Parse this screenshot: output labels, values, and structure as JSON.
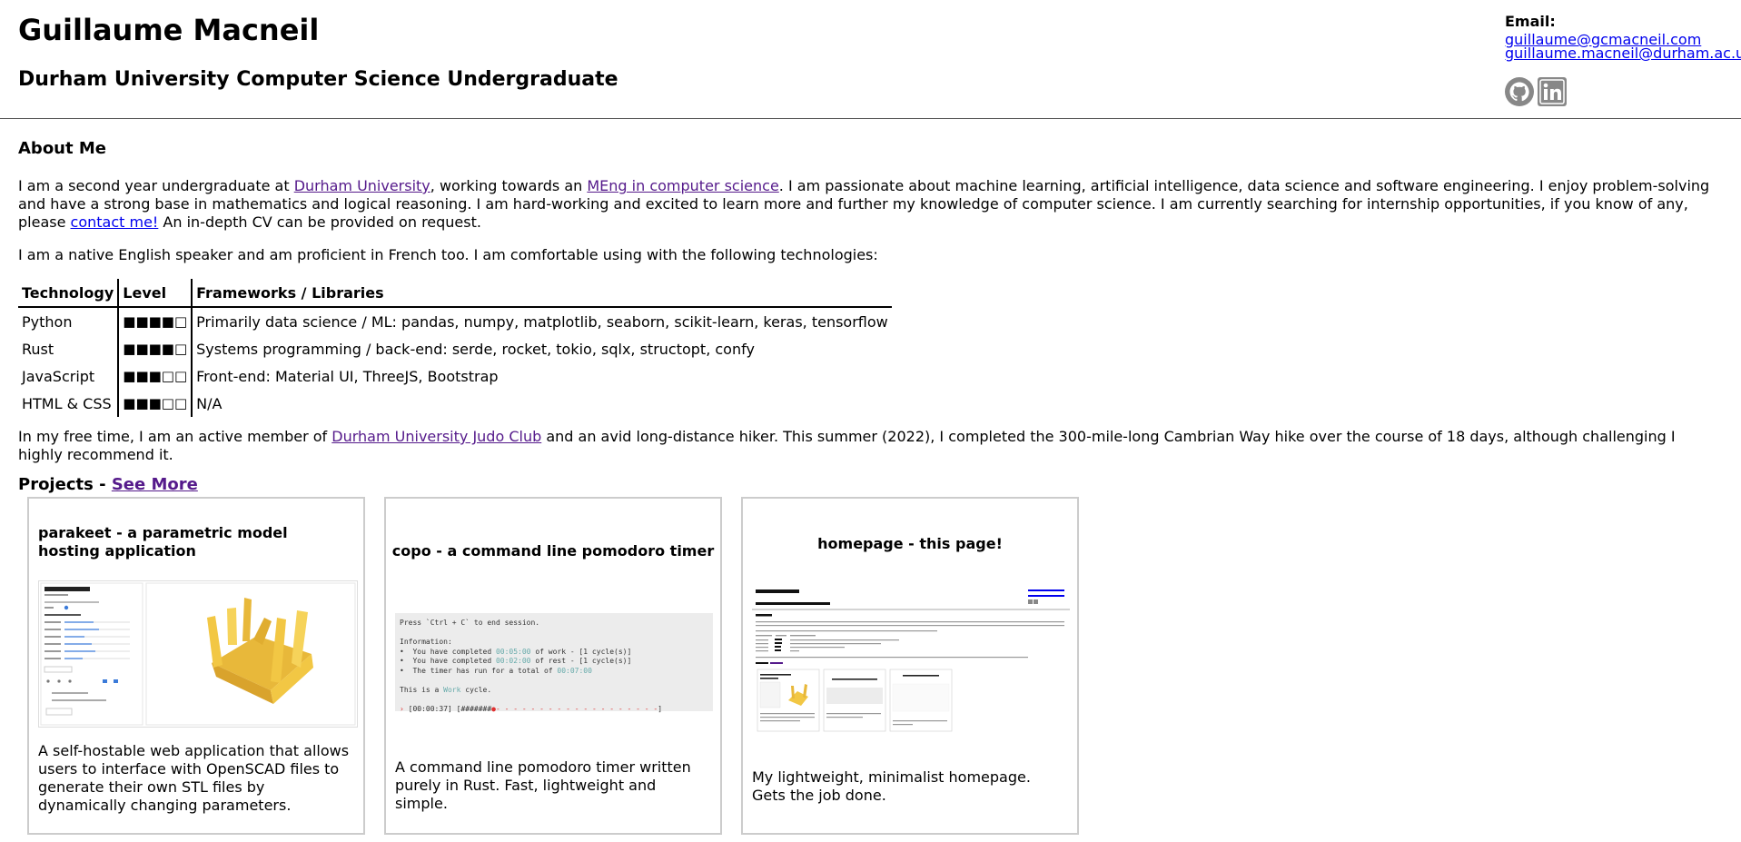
{
  "header": {
    "name": "Guillaume Macneil",
    "subtitle": "Durham University Computer Science Undergraduate",
    "email_label": "Email:",
    "email_primary": "guillaume@gcmacneil.com",
    "email_secondary": "guillaume.macneil@durham.ac.uk",
    "social": [
      {
        "icon": "github-icon"
      },
      {
        "icon": "linkedin-icon"
      }
    ]
  },
  "about": {
    "heading": "About Me",
    "p1_a": "I am a second year undergraduate at ",
    "p1_link1": "Durham University",
    "p1_b": ", working towards an ",
    "p1_link2": "MEng in computer science",
    "p1_c": ". I am passionate about machine learning, artificial intelligence, data science and software engineering. I enjoy problem-solving and have a strong base in mathematics and logical reasoning. I am hard-working and excited to learn more and further my knowledge of computer science. I am currently searching for internship opportunities, if you know of any, please ",
    "p1_link3": "contact me!",
    "p1_d": " An in-depth CV can be provided on request.",
    "p2": "I am a native English speaker and am proficient in French too. I am comfortable using with the following technologies:",
    "p3_a": "In my free time, I am an active member of ",
    "p3_link": "Durham University Judo Club",
    "p3_b": " and an avid long-distance hiker. This summer (2022), I completed the 300-mile-long Cambrian Way hike over the course of 18 days, although challenging I highly recommend it."
  },
  "tech_table": {
    "headers": [
      "Technology",
      "Level",
      "Frameworks / Libraries"
    ],
    "rows": [
      {
        "tech": "Python",
        "level": "■■■■□",
        "libs": "Primarily data science / ML: pandas, numpy, matplotlib, seaborn, scikit-learn, keras, tensorflow"
      },
      {
        "tech": "Rust",
        "level": "■■■■□",
        "libs": "Systems programming / back-end: serde, rocket, tokio, sqlx, structopt, confy"
      },
      {
        "tech": "JavaScript",
        "level": "■■■□□",
        "libs": "Front-end: Material UI, ThreeJS, Bootstrap"
      },
      {
        "tech": "HTML & CSS",
        "level": "■■■□□",
        "libs": "N/A"
      }
    ]
  },
  "projects": {
    "heading": "Projects - ",
    "see_more": "See More",
    "cards": [
      {
        "name": "parakeet",
        "tagline": " - a parametric model hosting application",
        "description": "A self-hostable web application that allows users to interface with OpenSCAD files to generate their own STL files by dynamically changing parameters."
      },
      {
        "name": "copo",
        "tagline": " - a command line pomodoro timer",
        "description": "A command line pomodoro timer written purely in Rust. Fast, lightweight and simple.",
        "terminal": {
          "line1": "Press `Ctrl + C` to end session.",
          "line2": "Information:",
          "line3a": "•  You have completed ",
          "line3t": "00:05:00",
          "line3b": " of work - [1 cycle(s)]",
          "line4a": "•  You have completed ",
          "line4t": "00:02:00",
          "line4b": " of rest - [1 cycle(s)]",
          "line5a": "•  The timer has run for a total of ",
          "line5t": "00:07:00",
          "line6a": "This is a ",
          "line6t": "Work",
          "line6b": " cycle.",
          "line7": "[00:00:37] [#######"
        }
      },
      {
        "name": "homepage",
        "tagline": " - this page!",
        "description": "My lightweight, minimalist homepage. Gets the job done."
      }
    ]
  },
  "colors": {
    "link_visited": "#551a8b",
    "link": "#0000ee",
    "model_yellow": "#f2c744",
    "progress_red": "#e03030"
  }
}
